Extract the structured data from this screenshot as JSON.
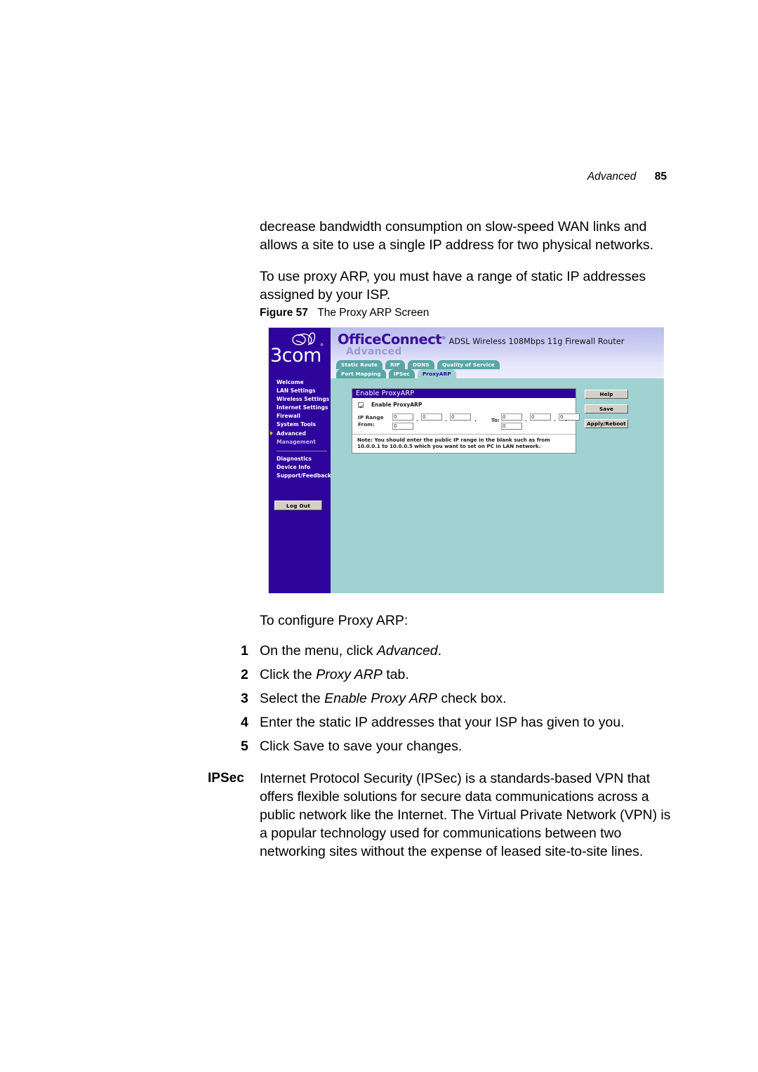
{
  "page": {
    "running_head": "Advanced",
    "page_number": "85"
  },
  "body": {
    "paragraphs": [
      "decrease bandwidth consumption on slow-speed WAN links and allows a site to use a single IP address for two physical networks.",
      "To use proxy ARP, you must have a range of static IP addresses assigned by your ISP."
    ]
  },
  "figure": {
    "number": "Figure 57",
    "title": "The Proxy ARP Screen"
  },
  "screenshot": {
    "logo": {
      "wordmark": "3com",
      "registered": "®",
      "icon": "3com-swirl-logo"
    },
    "brand": {
      "product": "OfficeConnect",
      "trademark": "®",
      "model": "ADSL Wireless 108Mbps 11g Firewall Router",
      "section": "Advanced"
    },
    "nav": {
      "items": [
        {
          "label": "Welcome",
          "selected": false,
          "dim": false
        },
        {
          "label": "LAN Settings",
          "selected": false,
          "dim": false
        },
        {
          "label": "Wireless Settings",
          "selected": false,
          "dim": false
        },
        {
          "label": "Internet Settings",
          "selected": false,
          "dim": false
        },
        {
          "label": "Firewall",
          "selected": false,
          "dim": false
        },
        {
          "label": "System Tools",
          "selected": false,
          "dim": false
        },
        {
          "label": "Advanced",
          "selected": true,
          "dim": false
        },
        {
          "label": "Management",
          "selected": false,
          "dim": true
        }
      ],
      "secondary_items": [
        {
          "label": "Diagnostics"
        },
        {
          "label": "Device Info"
        },
        {
          "label": "Support/Feedback"
        }
      ],
      "logout_label": "Log Out"
    },
    "tabs": {
      "row1": [
        {
          "label": "Static Route",
          "active": false
        },
        {
          "label": "RIP",
          "active": false
        },
        {
          "label": "DDNS",
          "active": false
        },
        {
          "label": "Quality of Service",
          "active": false
        }
      ],
      "row2": [
        {
          "label": "Port Mapping",
          "active": false
        },
        {
          "label": "IPSec",
          "active": false
        },
        {
          "label": "ProxyARP",
          "active": true
        }
      ]
    },
    "panel": {
      "title": "Enable ProxyARP",
      "checkbox": {
        "label": "Enable ProxyARP",
        "checked": true
      },
      "ip_range": {
        "from_label": "IP Range From:",
        "from_label_line1": "IP Range",
        "from_label_line2": "From:",
        "to_label": "To:",
        "from_values": [
          "0",
          "0",
          "0",
          "0"
        ],
        "to_values": [
          "0",
          "0",
          "0",
          "0"
        ],
        "separator": "."
      },
      "note": "Note: You should enter the public IP range in the blank such as from 10.0.0.1 to 10.0.0.5 which you want to set on PC in LAN network."
    },
    "buttons": [
      {
        "label": "Help"
      },
      {
        "label": "Save"
      },
      {
        "label": "Apply/Reboot"
      }
    ],
    "colors": {
      "nav_purple": "#2e049c",
      "body_teal": "#9fd2d0",
      "tab_teal": "#59a7a5",
      "header_lavender": "#cfd1f3",
      "button_gray": "#d4d0c8",
      "bullet_yellow": "#ffd400"
    }
  },
  "instructions": {
    "intro": "To configure Proxy ARP:",
    "steps": [
      {
        "num": "1",
        "pre": "On the menu, click ",
        "em": "Advanced",
        "post": "."
      },
      {
        "num": "2",
        "pre": "Click the ",
        "em": "Proxy ARP",
        "post": " tab."
      },
      {
        "num": "3",
        "pre": "Select the ",
        "em": "Enable Proxy ARP",
        "post": " check box."
      },
      {
        "num": "4",
        "pre": "Enter the static IP addresses that your ISP has given to you.",
        "em": "",
        "post": ""
      },
      {
        "num": "5",
        "pre": "Click Save to save your changes.",
        "em": "",
        "post": ""
      }
    ]
  },
  "ipsec": {
    "term": "IPSec",
    "description": "Internet Protocol Security (IPSec) is a standards-based VPN that offers flexible solutions for secure data communications across a public network like the Internet. The Virtual Private Network (VPN) is a popular technology used for communications between two networking sites without the expense of leased site-to-site lines."
  }
}
